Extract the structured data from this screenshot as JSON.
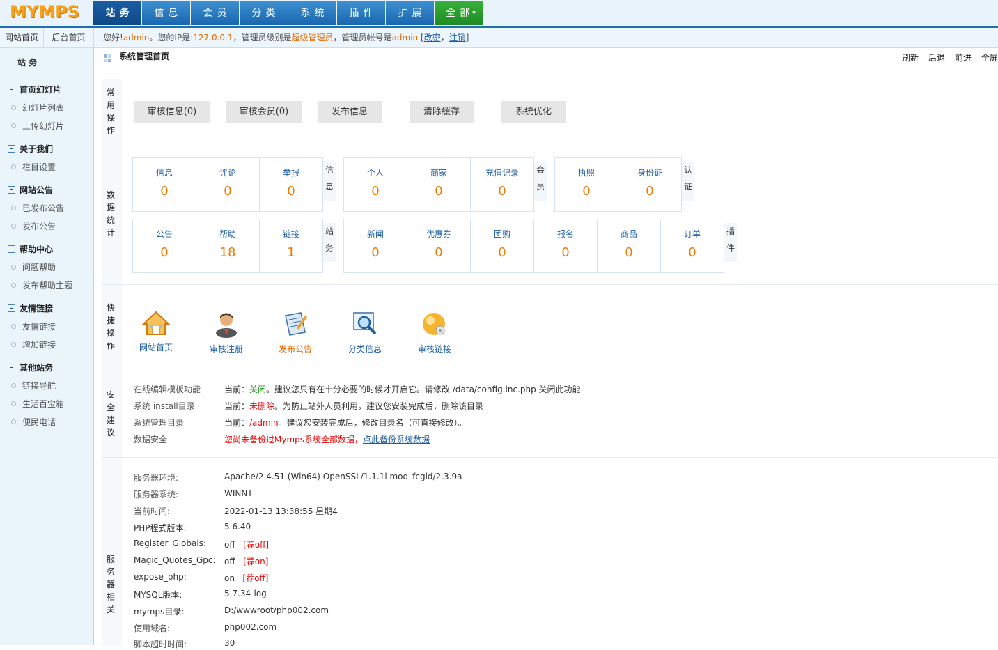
{
  "app": {
    "logo": "MYMPS"
  },
  "nav": [
    "站务",
    "信息",
    "会员",
    "分类",
    "系统",
    "插件",
    "扩展",
    "全部"
  ],
  "subnav": {
    "site_home": "网站首页",
    "admin_home": "后台首页"
  },
  "welcome": {
    "prefix": "您好!",
    "user": "admin",
    "ip_text": "。您的IP是:",
    "ip": "127.0.0.1",
    "level_text": "，管理员级别是",
    "level": "超级管理员",
    "account_text": "，管理员帐号是",
    "account": "admin",
    "change": "改密",
    "logout": "注销"
  },
  "sidebar": {
    "title": "站 务",
    "groups": [
      {
        "title": "首页幻灯片",
        "items": [
          "幻灯片列表",
          "上传幻灯片"
        ]
      },
      {
        "title": "关于我们",
        "items": [
          "栏目设置"
        ]
      },
      {
        "title": "网站公告",
        "items": [
          "已发布公告",
          "发布公告"
        ]
      },
      {
        "title": "帮助中心",
        "items": [
          "问题帮助",
          "发布帮助主题"
        ]
      },
      {
        "title": "友情链接",
        "items": [
          "友情链接",
          "增加链接"
        ]
      },
      {
        "title": "其他站务",
        "items": [
          "链接导航",
          "生活百宝箱",
          "便民电话"
        ]
      }
    ]
  },
  "header": {
    "title": "系统管理首页",
    "tools": [
      "刷新",
      "后退",
      "前进",
      "全屏"
    ]
  },
  "common_ops": {
    "label": "常用操作",
    "buttons": [
      "审核信息(0)",
      "审核会员(0)",
      "发布信息",
      "清除缓存",
      "系统优化"
    ]
  },
  "stats": {
    "label": "数据统计",
    "groups": [
      {
        "tag": "信息",
        "cells": [
          {
            "label": "信息",
            "value": "0"
          },
          {
            "label": "评论",
            "value": "0"
          },
          {
            "label": "举报",
            "value": "0"
          }
        ]
      },
      {
        "tag": "会员",
        "cells": [
          {
            "label": "个人",
            "value": "0"
          },
          {
            "label": "商家",
            "value": "0"
          },
          {
            "label": "充值记录",
            "value": "0"
          }
        ]
      },
      {
        "tag": "认证",
        "cells": [
          {
            "label": "执照",
            "value": "0"
          },
          {
            "label": "身份证",
            "value": "0"
          }
        ]
      },
      {
        "tag": "站务",
        "cells": [
          {
            "label": "公告",
            "value": "0"
          },
          {
            "label": "帮助",
            "value": "18"
          },
          {
            "label": "链接",
            "value": "1"
          }
        ]
      },
      {
        "tag": "插件",
        "cells": [
          {
            "label": "新闻",
            "value": "0"
          },
          {
            "label": "优惠券",
            "value": "0"
          },
          {
            "label": "团购",
            "value": "0"
          },
          {
            "label": "报名",
            "value": "0"
          },
          {
            "label": "商品",
            "value": "0"
          },
          {
            "label": "订单",
            "value": "0"
          }
        ]
      }
    ]
  },
  "quick": {
    "label": "快捷操作",
    "items": [
      {
        "label": "网站首页",
        "icon": "house-icon"
      },
      {
        "label": "审核注册",
        "icon": "user-icon"
      },
      {
        "label": "发布公告",
        "icon": "publish-icon"
      },
      {
        "label": "分类信息",
        "icon": "magnifier-icon"
      },
      {
        "label": "审核链接",
        "icon": "link-review-icon"
      }
    ]
  },
  "security": {
    "label": "安全建议",
    "rows": [
      {
        "name": "在线编辑模板功能",
        "prefix": "当前：",
        "status": "关闭",
        "suffix": "。建议您只有在十分必要的时候才开启它。请修改 /data/config.inc.php 关闭此功能"
      },
      {
        "name": "系统 install目录",
        "prefix": "当前：",
        "status": "未删除",
        "suffix": "。为防止站外人员利用，建议您安装完成后，删除该目录"
      },
      {
        "name": "系统管理目录",
        "prefix": "当前：",
        "status": "/admin",
        "suffix": "。建议您安装完成后，修改目录名（可直接修改）。"
      },
      {
        "name": "数据安全",
        "warning": "您尚未备份过Mymps系统全部数据，",
        "link": "点此备份系统数据"
      }
    ]
  },
  "server": {
    "label": "服务器相关",
    "rows": [
      {
        "name": "服务器环境:",
        "value": "Apache/2.4.51 (Win64) OpenSSL/1.1.1l mod_fcgid/2.3.9a"
      },
      {
        "name": "服务器系统:",
        "value": "WINNT"
      },
      {
        "name": "当前时间:",
        "value": "2022-01-13 13:38:55 星期4"
      },
      {
        "name": "PHP程式版本:",
        "value": "5.6.40"
      },
      {
        "name": "Register_Globals:",
        "value": "off",
        "rec": "[荐off]"
      },
      {
        "name": "Magic_Quotes_Gpc:",
        "value": "off",
        "rec": "[荐on]"
      },
      {
        "name": "expose_php:",
        "value": "on",
        "rec": "[荐off]"
      },
      {
        "name": "MYSQL版本:",
        "value": "5.7.34-log"
      },
      {
        "name": "mymps目录:",
        "value": "D:/wwwroot/php002.com"
      },
      {
        "name": "使用域名:",
        "value": "php002.com"
      },
      {
        "name": "脚本超时时间:",
        "value": "30"
      }
    ]
  },
  "colors": {
    "nav_blue": "#1a66b0",
    "accent_orange": "#f07a00",
    "link_blue": "#1a5da4",
    "warn_red": "#e00000",
    "ok_green": "#1d9b1d"
  }
}
